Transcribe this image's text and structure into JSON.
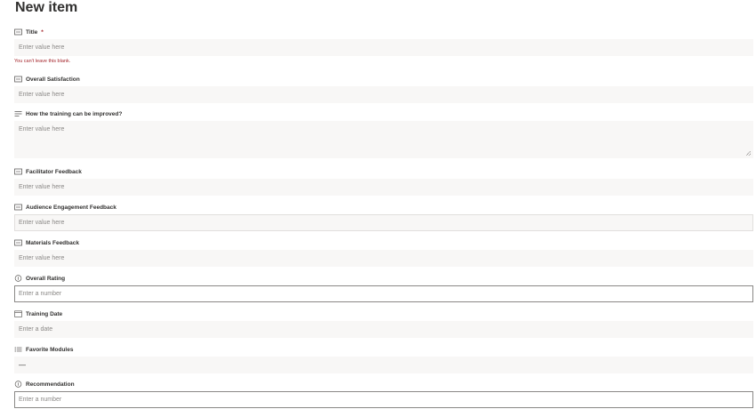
{
  "page": {
    "title": "New item"
  },
  "fields": {
    "title": {
      "label": "Title",
      "required_mark": "*",
      "placeholder": "Enter value here",
      "error": "You can't leave this blank."
    },
    "overall_satisfaction": {
      "label": "Overall Satisfaction",
      "placeholder": "Enter value here"
    },
    "training_improved": {
      "label": "How the training can be improved?",
      "placeholder": "Enter value here"
    },
    "facilitator_feedback": {
      "label": "Facilitator Feedback",
      "placeholder": "Enter value here"
    },
    "audience_engagement": {
      "label": "Audience Engagement Feedback",
      "placeholder": "Enter value here"
    },
    "materials_feedback": {
      "label": "Materials Feedback",
      "placeholder": "Enter value here"
    },
    "overall_rating": {
      "label": "Overall Rating",
      "placeholder": "Enter a number"
    },
    "training_date": {
      "label": "Training Date",
      "placeholder": "Enter a date"
    },
    "favorite_modules": {
      "label": "Favorite Modules",
      "value": "—"
    },
    "recommendation": {
      "label": "Recommendation",
      "placeholder": "Enter a number"
    }
  },
  "icons": {
    "text": "single-line-text-icon",
    "multiline": "multiline-text-icon",
    "number": "number-icon",
    "date": "calendar-icon",
    "choice": "choice-icon"
  },
  "colors": {
    "error": "#a4262c",
    "field_bg": "#f8f7f6",
    "text": "#323130",
    "placeholder": "#8a8886"
  }
}
